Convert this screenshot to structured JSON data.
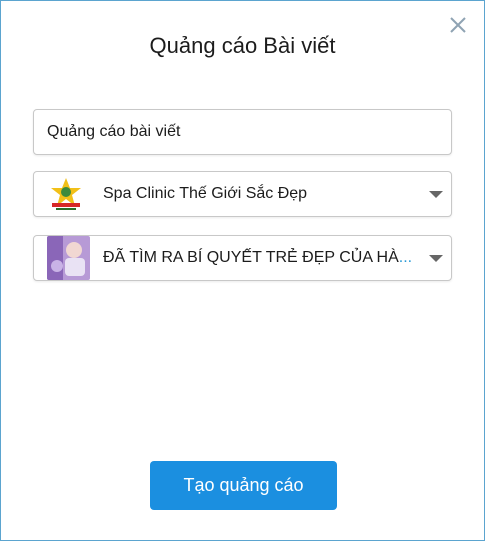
{
  "dialog": {
    "title": "Quảng cáo Bài viết",
    "close_icon": "close-icon"
  },
  "form": {
    "name_input_value": "Quảng cáo bài viết",
    "page_select": {
      "selected": "Spa Clinic Thế Giới Sắc Đẹp",
      "thumbnail_icon": "page-logo-icon"
    },
    "post_select": {
      "selected": "ĐÃ TÌM RA BÍ QUYẾT TRẺ ĐẸP CỦA HÀ",
      "truncation": "...",
      "thumbnail_icon": "post-thumbnail-icon"
    }
  },
  "footer": {
    "create_button_label": "Tạo quảng cáo"
  },
  "colors": {
    "accent": "#1b8fe0",
    "border": "#5ba4cf",
    "text": "#1c1c1c"
  }
}
